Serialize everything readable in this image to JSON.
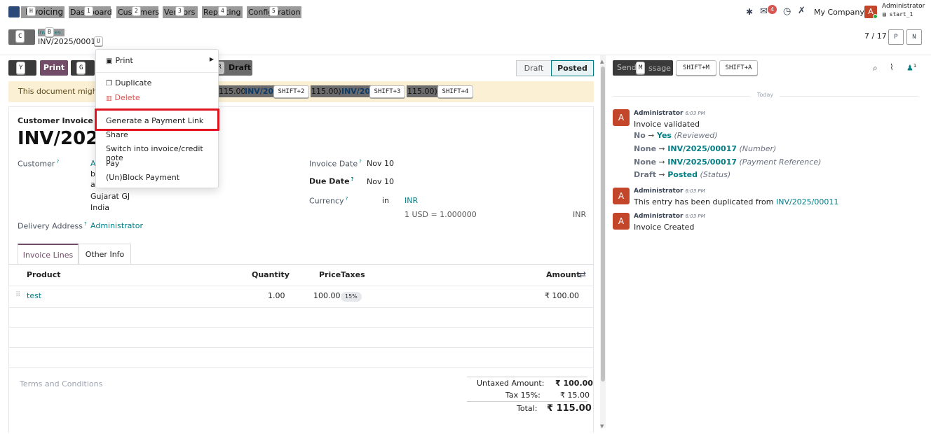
{
  "nav": {
    "app_letters": "Invoicing",
    "menus": [
      {
        "label": "Dashboard",
        "hint": "1"
      },
      {
        "label": "Customers",
        "hint": "2"
      },
      {
        "label": "Vendors",
        "hint": "3"
      },
      {
        "label": "Reporting",
        "hint": "4"
      },
      {
        "label": "Configuration",
        "hint": "5"
      }
    ],
    "home_hint": "H",
    "chat_badge": "4",
    "company": "My Company",
    "user_name": "Administrator",
    "user_db": "start_1",
    "avatar_letter": "A"
  },
  "breadcrumb": {
    "back_hint": "C",
    "parent_hint": "B",
    "parent": "Invoices",
    "current": "INV/2025/00017",
    "gear_hint": "U",
    "pager": "7 / 17",
    "prev_hint": "P",
    "next_hint": "N"
  },
  "actions": {
    "send_hint": "Y",
    "send_label": "Send",
    "print_label": "Print",
    "print_hint": "G",
    "reset_hint": "R",
    "reset_label": "Reset to Draft",
    "draft_text": "Draft"
  },
  "status": {
    "draft": "Draft",
    "posted": "Posted"
  },
  "warning": {
    "prefix": "This document might b",
    "p1": "115.00)",
    "link2": "INV/202",
    "hint2": "SHIFT+2",
    "p2": "115.00)",
    "link3": "INV/202",
    "hint3": "SHIFT+3",
    "p3": "115.00)",
    "hint4": "SHIFT+4"
  },
  "dropdown": {
    "print": "Print",
    "duplicate": "Duplicate",
    "delete": "Delete",
    "generate_link": "Generate a Payment Link",
    "share": "Share",
    "switch": "Switch into invoice/credit note",
    "pay": "Pay",
    "block": "(Un)Block Payment"
  },
  "invoice": {
    "type": "Customer Invoice",
    "number": "INV/2025/",
    "customer_label": "Customer",
    "customer_short": "A",
    "addr1": "b",
    "addr2": "a",
    "state": "Gujarat GJ",
    "country": "India",
    "delivery_label": "Delivery Address",
    "delivery_value": "Administrator",
    "invoice_date_label": "Invoice Date",
    "invoice_date": "Nov 10",
    "due_date_label": "Due Date",
    "due_date": "Nov 10",
    "currency_label": "Currency",
    "currency_in": "in",
    "currency": "INR",
    "rate": "1 USD = 1.000000",
    "rate_cur": "INR"
  },
  "tabs": {
    "lines": "Invoice Lines",
    "other": "Other Info"
  },
  "table": {
    "headers": {
      "product": "Product",
      "quantity": "Quantity",
      "price": "Price",
      "taxes": "Taxes",
      "amount": "Amount"
    },
    "rows": [
      {
        "product": "test",
        "quantity": "1.00",
        "price": "100.00",
        "tax": "15%",
        "amount": "₹ 100.00"
      }
    ]
  },
  "totals": {
    "terms": "Terms and Conditions",
    "untaxed_label": "Untaxed Amount:",
    "untaxed": "₹ 100.00",
    "tax_label": "Tax 15%:",
    "tax": "₹ 15.00",
    "total_label": "Total:",
    "total": "₹ 115.00"
  },
  "chatter": {
    "send_label": "Send",
    "send_hint": "M",
    "send_suffix": "ssage",
    "shift_m": "SHIFT+M",
    "shift_a": "SHIFT+A",
    "followers": "1",
    "today": "Today",
    "messages": [
      {
        "author": "Administrator",
        "time": "6:03 PM",
        "text": "Invoice validated"
      },
      {
        "author": "Administrator",
        "time": "6:03 PM",
        "text": "This entry has been duplicated from",
        "link": "INV/2025/00011"
      },
      {
        "author": "Administrator",
        "time": "6:03 PM",
        "text": "Invoice Created"
      }
    ],
    "tracking": [
      {
        "old": "No",
        "new": "Yes",
        "field": "(Reviewed)"
      },
      {
        "old": "None",
        "new": "INV/2025/00017",
        "field": "(Number)"
      },
      {
        "old": "None",
        "new": "INV/2025/00017",
        "field": "(Payment Reference)"
      },
      {
        "old": "Draft",
        "new": "Posted",
        "field": "(Status)"
      }
    ]
  }
}
